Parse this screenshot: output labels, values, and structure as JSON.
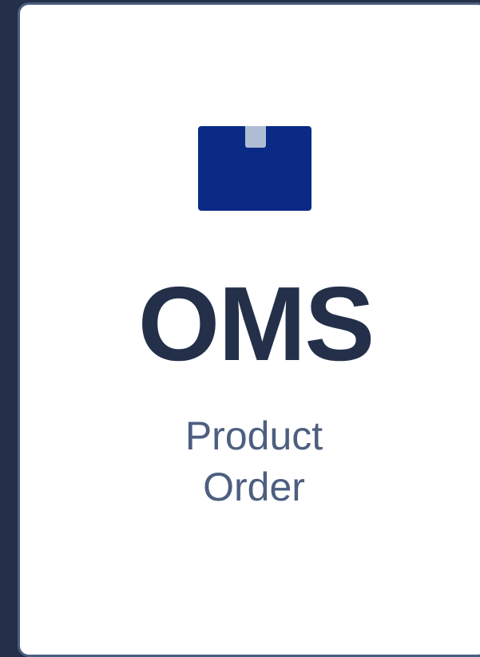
{
  "app": {
    "title": "OMS",
    "subtitle_lines": [
      "Product",
      "Order"
    ]
  },
  "icons": {
    "logo": "package-box-icon"
  },
  "colors": {
    "background": "#24304a",
    "card": "#ffffff",
    "card_border": "#4b5d80",
    "logo_primary": "#0a2a86",
    "logo_tab": "#aebdd3",
    "title_text": "#24304a",
    "subtitle_text": "#4d5f7f"
  }
}
